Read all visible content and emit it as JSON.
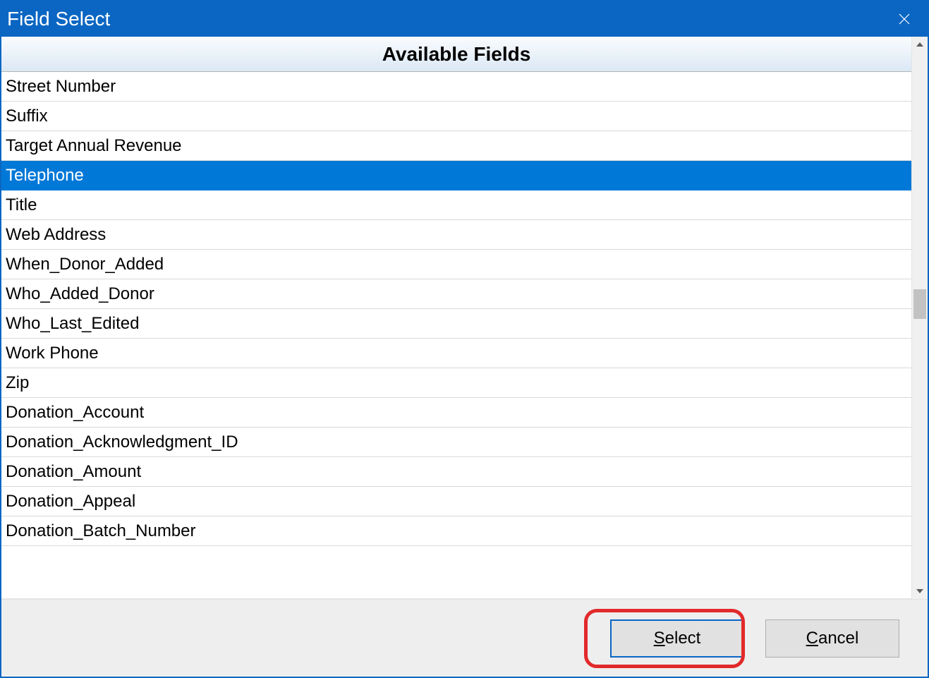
{
  "window": {
    "title": "Field Select"
  },
  "header": {
    "column_label": "Available Fields"
  },
  "fields": [
    {
      "label": "Street Number",
      "selected": false
    },
    {
      "label": "Suffix",
      "selected": false
    },
    {
      "label": "Target Annual Revenue",
      "selected": false
    },
    {
      "label": "Telephone",
      "selected": true
    },
    {
      "label": "Title",
      "selected": false
    },
    {
      "label": "Web Address",
      "selected": false
    },
    {
      "label": "When_Donor_Added",
      "selected": false
    },
    {
      "label": "Who_Added_Donor",
      "selected": false
    },
    {
      "label": "Who_Last_Edited",
      "selected": false
    },
    {
      "label": "Work Phone",
      "selected": false
    },
    {
      "label": "Zip",
      "selected": false
    },
    {
      "label": "Donation_Account",
      "selected": false
    },
    {
      "label": "Donation_Acknowledgment_ID",
      "selected": false
    },
    {
      "label": "Donation_Amount",
      "selected": false
    },
    {
      "label": "Donation_Appeal",
      "selected": false
    },
    {
      "label": "Donation_Batch_Number",
      "selected": false
    }
  ],
  "buttons": {
    "select_prefix": "S",
    "select_rest": "elect",
    "cancel_prefix": "C",
    "cancel_rest": "ancel"
  }
}
